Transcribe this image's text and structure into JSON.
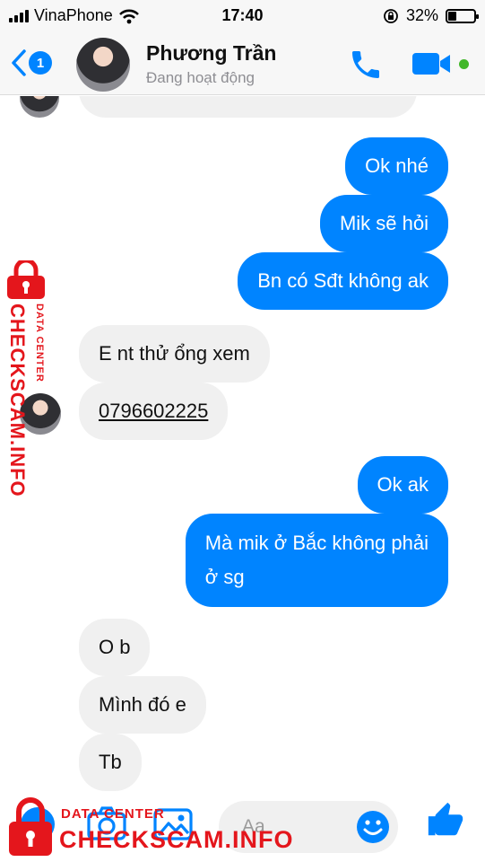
{
  "status_bar": {
    "carrier": "VinaPhone",
    "time": "17:40",
    "battery_percent": "32%",
    "battery_level": 0.32,
    "icons": [
      "signal-bars-icon",
      "wifi-icon",
      "rotation-lock-icon",
      "battery-icon"
    ]
  },
  "header": {
    "back_badge_count": "1",
    "contact_name": "Phương Trần",
    "contact_status": "Đang hoạt động",
    "icons": [
      "back-chevron-icon",
      "phone-icon",
      "video-camera-icon",
      "online-dot-icon"
    ]
  },
  "messages": [
    {
      "direction": "outgoing",
      "text": "Ok nhé"
    },
    {
      "direction": "outgoing",
      "text": "Mik sẽ hỏi"
    },
    {
      "direction": "outgoing",
      "text": "Bn có Sđt không ak"
    },
    {
      "direction": "incoming",
      "text": "E nt thử ổng xem"
    },
    {
      "direction": "incoming",
      "text": "0796602225"
    },
    {
      "direction": "outgoing",
      "text": "Ok ak"
    },
    {
      "direction": "outgoing",
      "text": "Mà mik ở Bắc không phải\nở sg"
    },
    {
      "direction": "incoming",
      "text": "O b"
    },
    {
      "direction": "incoming",
      "text": "Mình đó e"
    },
    {
      "direction": "incoming",
      "text": "Tb"
    }
  ],
  "composer": {
    "placeholder": "Aa",
    "icons": [
      "more-icon",
      "camera-icon",
      "image-icon",
      "emoji-icon",
      "thumbs-up-icon"
    ]
  },
  "watermark": {
    "brand": "CHECKSCAM.INFO",
    "subtitle": "DATA CENTER"
  },
  "colors": {
    "accent": "#0084ff",
    "incoming_bubble": "#f0f0f0",
    "online": "#42b72a",
    "watermark": "#e4161c"
  }
}
